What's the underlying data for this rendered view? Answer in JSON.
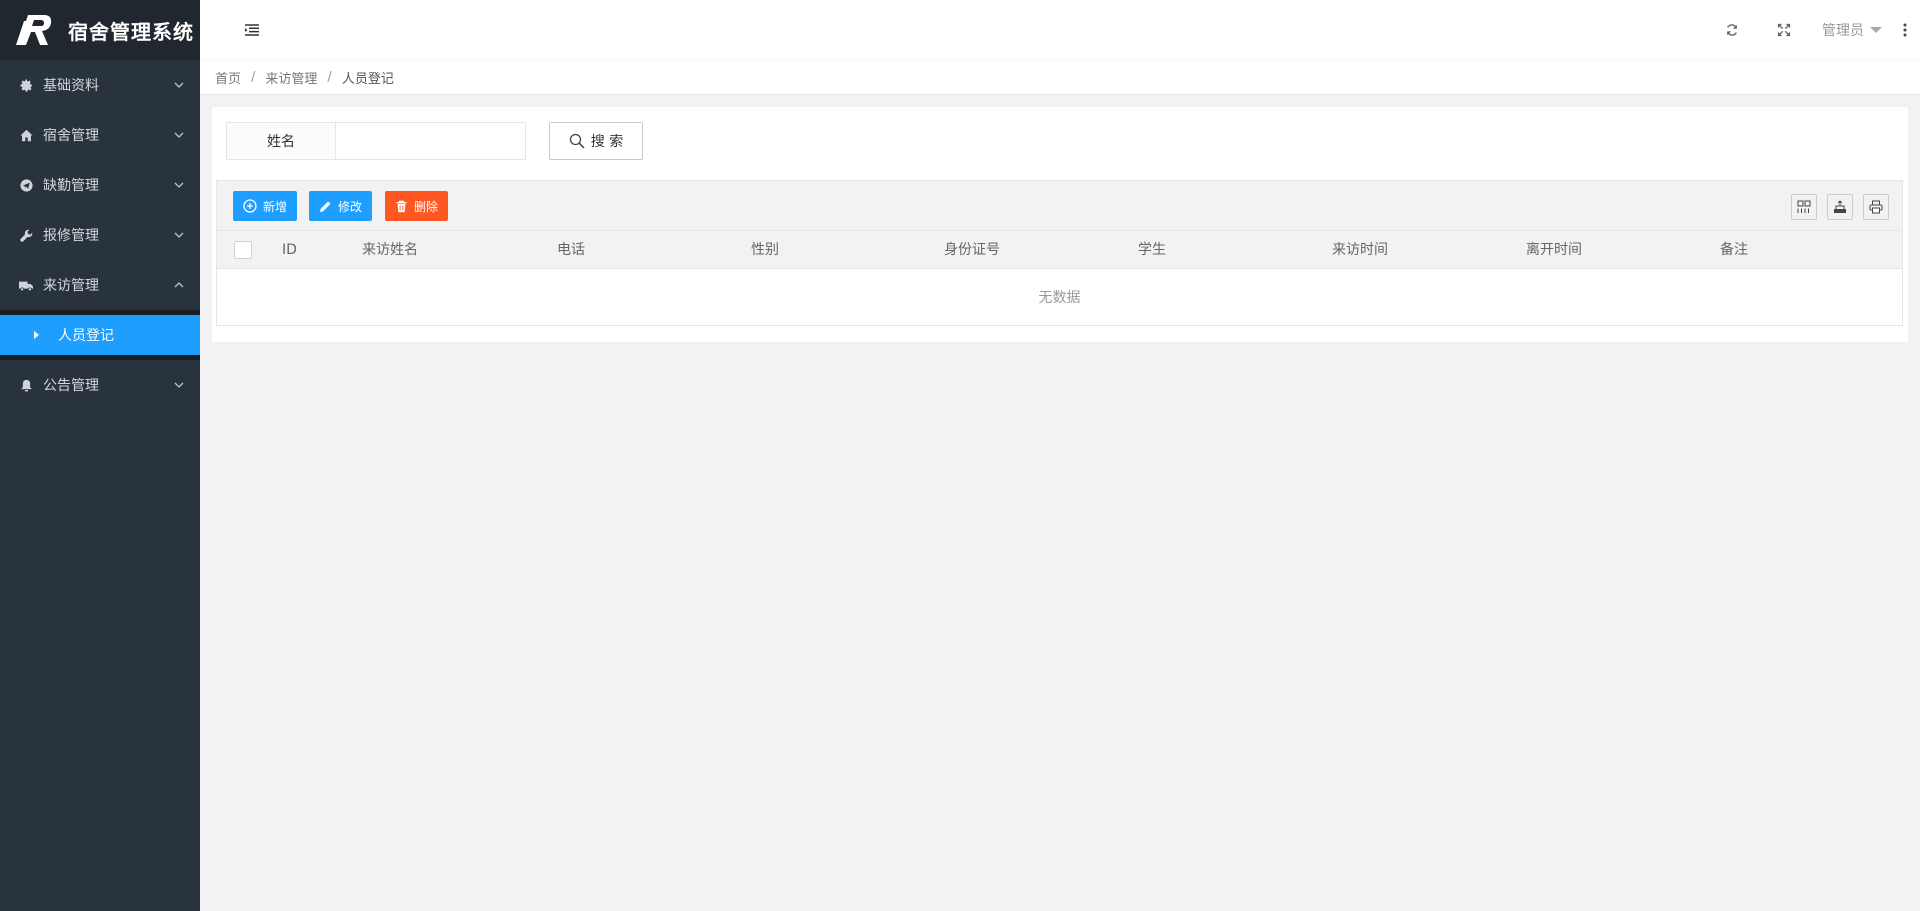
{
  "app": {
    "title": "宿舍管理系统",
    "logo_icon": "r-letter-logo",
    "accent_color": "#1e9fff",
    "danger_color": "#ff5722",
    "sidebar_color": "#28333e"
  },
  "sidebar": {
    "items": [
      {
        "label": "基础资料",
        "icon": "gear-icon",
        "expanded": false
      },
      {
        "label": "宿舍管理",
        "icon": "home-icon",
        "expanded": false
      },
      {
        "label": "缺勤管理",
        "icon": "send-icon",
        "expanded": false
      },
      {
        "label": "报修管理",
        "icon": "wrench-icon",
        "expanded": false
      },
      {
        "label": "来访管理",
        "icon": "truck-icon",
        "expanded": true,
        "children": [
          {
            "label": "人员登记",
            "active": true
          }
        ]
      },
      {
        "label": "公告管理",
        "icon": "bell-icon",
        "expanded": false
      }
    ]
  },
  "header": {
    "user": "管理员",
    "icons": [
      "menu-toggle-icon",
      "refresh-icon",
      "fullscreen-icon",
      "more-icon"
    ]
  },
  "breadcrumb": [
    "首页",
    "来访管理",
    "人员登记"
  ],
  "search": {
    "label": "姓名",
    "value": "",
    "placeholder": "",
    "button": "搜 索"
  },
  "toolbar": {
    "add": "新增",
    "edit": "修改",
    "delete": "删除",
    "right_icons": [
      "columns-icon",
      "export-icon",
      "print-icon"
    ]
  },
  "table": {
    "columns": [
      "ID",
      "来访姓名",
      "电话",
      "性别",
      "身份证号",
      "学生",
      "来访时间",
      "离开时间",
      "备注"
    ],
    "rows": [],
    "empty_text": "无数据"
  }
}
